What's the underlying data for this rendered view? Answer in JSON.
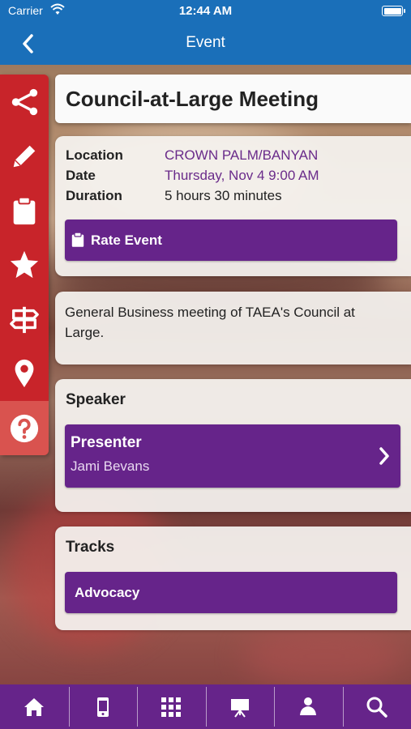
{
  "status_bar": {
    "carrier": "Carrier",
    "time": "12:44 AM"
  },
  "nav": {
    "title": "Event",
    "back_icon": "chevron-left-icon"
  },
  "sidebar": {
    "items": [
      {
        "icon": "share-icon"
      },
      {
        "icon": "pencil-icon"
      },
      {
        "icon": "clipboard-icon"
      },
      {
        "icon": "star-icon"
      },
      {
        "icon": "signpost-icon"
      },
      {
        "icon": "map-pin-icon"
      },
      {
        "icon": "help-icon"
      }
    ]
  },
  "event": {
    "title": "Council-at-Large Meeting",
    "location_label": "Location",
    "location": "CROWN PALM/BANYAN",
    "date_label": "Date",
    "date": "Thursday, Nov 4 9:00 AM",
    "duration_label": "Duration",
    "duration": "5 hours 30 minutes",
    "rate_label": "Rate Event",
    "description": "General Business meeting of TAEA's Council at Large."
  },
  "speaker": {
    "heading": "Speaker",
    "role": "Presenter",
    "name": "Jami Bevans"
  },
  "tracks": {
    "heading": "Tracks",
    "items": [
      "Advocacy"
    ]
  },
  "tabbar": {
    "items": [
      {
        "icon": "home-icon"
      },
      {
        "icon": "mobile-icon"
      },
      {
        "icon": "grid-icon"
      },
      {
        "icon": "presentation-icon"
      },
      {
        "icon": "person-icon"
      },
      {
        "icon": "search-icon"
      }
    ]
  },
  "colors": {
    "brand_blue": "#1a6fb9",
    "brand_purple": "#66248a",
    "sidebar_red": "#c8242a"
  }
}
